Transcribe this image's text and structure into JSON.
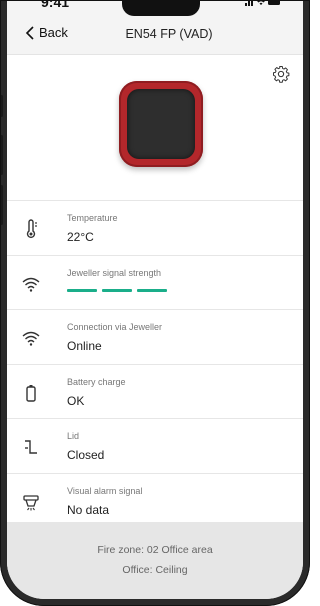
{
  "status_bar": {
    "time": "9:41",
    "icons": "..ıl ≈ ▬"
  },
  "nav": {
    "back_label": "Back",
    "title": "EN54 FP (VAD)"
  },
  "rows": [
    {
      "label": "Temperature",
      "value": "22°C",
      "icon": "thermometer-icon"
    },
    {
      "label": "Jeweller signal strength",
      "value": "",
      "icon": "signal-icon",
      "signal_bars": 3
    },
    {
      "label": "Connection via Jeweller",
      "value": "Online",
      "icon": "signal-icon"
    },
    {
      "label": "Battery charge",
      "value": "OK",
      "icon": "battery-icon"
    },
    {
      "label": "Lid",
      "value": "Closed",
      "icon": "lid-icon"
    },
    {
      "label": "Visual alarm signal",
      "value": "No data",
      "icon": "visual-alarm-icon"
    }
  ],
  "footer": {
    "fire_zone": "Fire zone: 02 Office area",
    "office": "Office: Ceiling"
  },
  "colors": {
    "accent_green": "#1aae8a",
    "device_red": "#b3272b"
  }
}
